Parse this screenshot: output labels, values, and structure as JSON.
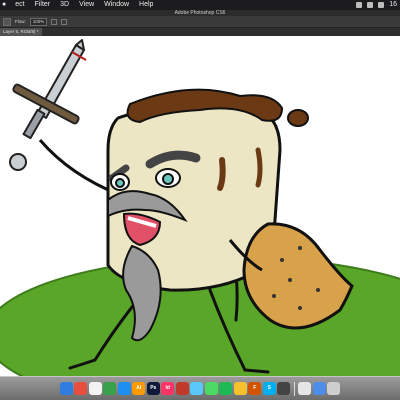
{
  "menubar": {
    "items": [
      "ect",
      "Filter",
      "3D",
      "View",
      "Window",
      "Help"
    ],
    "status_number": "16"
  },
  "window": {
    "title": "Adobe Photoshop CS6"
  },
  "options": {
    "flow_label": "Flow:",
    "flow_value": "100%"
  },
  "document_tab": {
    "label": "Layer 5, RGB/8) *"
  },
  "dock": {
    "icons": [
      {
        "name": "finder-icon",
        "color": "#2f7de1",
        "glyph": ""
      },
      {
        "name": "chrome-icon",
        "color": "#e84e3d",
        "glyph": ""
      },
      {
        "name": "calendar-icon",
        "color": "#f2f2f2",
        "glyph": ""
      },
      {
        "name": "numbers-icon",
        "color": "#3aa14b",
        "glyph": ""
      },
      {
        "name": "appstore-icon",
        "color": "#1f8ef1",
        "glyph": ""
      },
      {
        "name": "illustrator-icon",
        "color": "#ff9a00",
        "glyph": "Ai"
      },
      {
        "name": "photoshop-icon",
        "color": "#0d1a3a",
        "glyph": "Ps"
      },
      {
        "name": "indesign-icon",
        "color": "#ff3366",
        "glyph": "Id"
      },
      {
        "name": "camera-icon",
        "color": "#c03a2b",
        "glyph": ""
      },
      {
        "name": "messages-icon",
        "color": "#5ac8fa",
        "glyph": ""
      },
      {
        "name": "facetime-icon",
        "color": "#4cd964",
        "glyph": ""
      },
      {
        "name": "spotify-icon",
        "color": "#1db954",
        "glyph": ""
      },
      {
        "name": "app-icon",
        "color": "#f6c12c",
        "glyph": ""
      },
      {
        "name": "font-icon",
        "color": "#d35400",
        "glyph": "F"
      },
      {
        "name": "skype-icon",
        "color": "#00aff0",
        "glyph": "S"
      },
      {
        "name": "audio-icon",
        "color": "#444444",
        "glyph": ""
      },
      {
        "name": "textedit-icon",
        "color": "#e6e6e6",
        "glyph": ""
      },
      {
        "name": "folder-icon",
        "color": "#4d8ce8",
        "glyph": ""
      },
      {
        "name": "trash-icon",
        "color": "#cfcfcf",
        "glyph": ""
      }
    ]
  }
}
